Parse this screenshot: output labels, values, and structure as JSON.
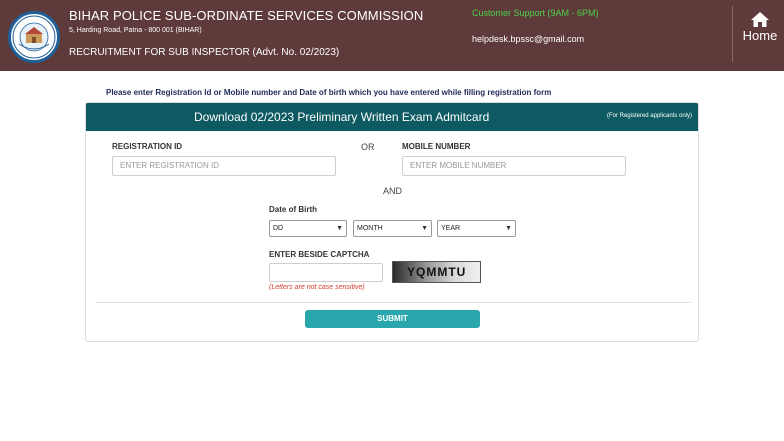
{
  "header": {
    "logo_text": "BPSSC",
    "org_name": "BIHAR POLICE SUB-ORDINATE SERVICES COMMISSION",
    "address": "5, Harding Road, Patna - 800 001 (BIHAR)",
    "recruitment": "RECRUITMENT FOR SUB INSPECTOR (Advt. No. 02/2023)",
    "support": "Customer Support (9AM - 6PM)",
    "helpdesk_email": "helpdesk.bpssc@gmail.com",
    "home_label": "Home",
    "home_icon": "house-icon",
    "colors": {
      "header_bg": "#5e3b3a",
      "support_text": "#4fcf4a"
    }
  },
  "instruction": "Please enter Registration Id or Mobile number and Date of birth which you have entered while filling registration form",
  "panel": {
    "title": "Download 02/2023 Preliminary Written Exam Admitcard",
    "note": "(For Registered applicants only)",
    "colors": {
      "head_bg": "#0e5a63",
      "submit_bg": "#2aa7ad"
    }
  },
  "form": {
    "registration_label": "REGISTRATION ID",
    "registration_placeholder": "ENTER REGISTRATION ID",
    "or_text": "OR",
    "mobile_label": "MOBILE NUMBER",
    "mobile_placeholder": "ENTER MOBILE NUMBER",
    "and_text": "AND",
    "dob_label": "Date of Birth",
    "day_select": "DD",
    "month_select": "MONTH",
    "year_select": "YEAR",
    "captcha_label": "ENTER BESIDE CAPTCHA",
    "captcha_value": "",
    "captcha_code": "YQMMTU",
    "captcha_hint": "(Letters are not case sensitive)",
    "submit_label": "SUBMIT"
  }
}
